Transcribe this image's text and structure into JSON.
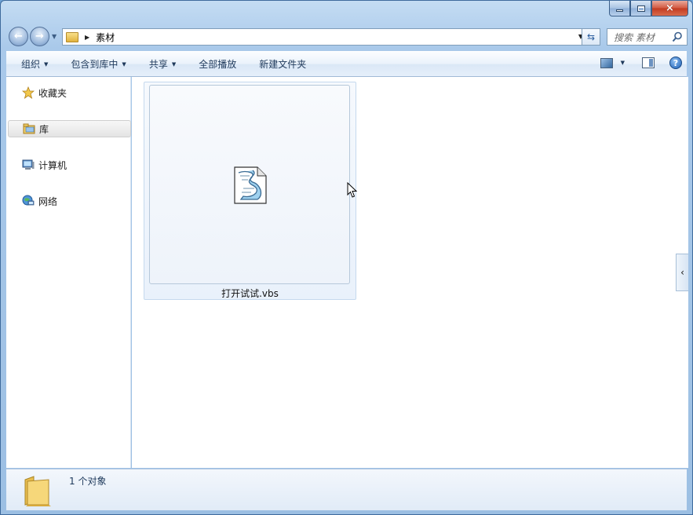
{
  "window": {
    "caption": {
      "minimize": "minimize",
      "maximize": "maximize",
      "close": "×"
    }
  },
  "address_bar": {
    "crumb": "素材",
    "search_placeholder": "搜索 素材"
  },
  "command_bar": {
    "organize": "组织",
    "include_in_library": "包含到库中",
    "share": "共享",
    "play_all": "全部播放",
    "new_folder": "新建文件夹"
  },
  "nav_pane": {
    "items": [
      {
        "label": "收藏夹",
        "icon": "star-icon"
      },
      {
        "label": "库",
        "icon": "library-icon"
      },
      {
        "label": "计算机",
        "icon": "computer-icon"
      },
      {
        "label": "网络",
        "icon": "network-icon"
      }
    ]
  },
  "files": [
    {
      "name": "打开试试.vbs",
      "icon": "vbs-script-icon"
    }
  ],
  "details_pane": {
    "count": "1 个对象"
  },
  "colors": {
    "accent": "#1e395b",
    "frame": "#9cbfe3",
    "selection_border": "#c5d9ee"
  }
}
